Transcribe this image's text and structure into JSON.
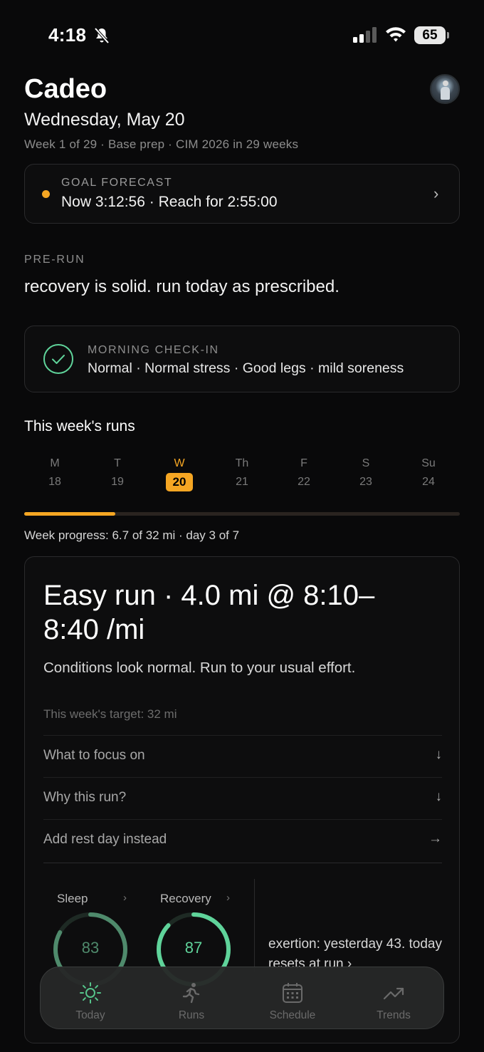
{
  "status": {
    "time": "4:18",
    "battery": "65"
  },
  "header": {
    "title": "Cadeo",
    "date": "Wednesday, May 20",
    "week_line": "Week 1 of 29 · Base prep · CIM 2026 in 29 weeks"
  },
  "goal": {
    "label": "GOAL FORECAST",
    "value": "Now 3:12:56 · Reach for 2:55:00",
    "accent": "#f5a623"
  },
  "prerun": {
    "label": "PRE-RUN",
    "text": "recovery is solid. run today as prescribed."
  },
  "checkin": {
    "label": "MORNING CHECK-IN",
    "text": "Normal · Normal stress · Good legs · mild soreness"
  },
  "week": {
    "title": "This week's runs",
    "days": [
      {
        "letter": "M",
        "num": "18"
      },
      {
        "letter": "T",
        "num": "19"
      },
      {
        "letter": "W",
        "num": "20"
      },
      {
        "letter": "Th",
        "num": "21"
      },
      {
        "letter": "F",
        "num": "22"
      },
      {
        "letter": "S",
        "num": "23"
      },
      {
        "letter": "Su",
        "num": "24"
      }
    ],
    "today_index": 2,
    "progress_fraction": 0.209,
    "progress_text": "Week progress: 6.7 of 32 mi · day 3 of 7"
  },
  "run": {
    "title": "Easy run · 4.0 mi @ 8:10–8:40 /mi",
    "subtitle": "Conditions look normal. Run to your usual effort.",
    "target": "This week's target: 32 mi",
    "rows": [
      {
        "label": "What to focus on",
        "arrow": "↓"
      },
      {
        "label": "Why this run?",
        "arrow": "↓"
      },
      {
        "label": "Add rest day instead",
        "arrow": "→"
      }
    ],
    "sleep": {
      "label": "Sleep",
      "value": "83",
      "fraction": 0.83,
      "color": "#4f8a6c"
    },
    "recovery": {
      "label": "Recovery",
      "value": "87",
      "fraction": 0.87,
      "color": "#5fd39a"
    },
    "exertion": "exertion: yesterday 43. today resets at run ›"
  },
  "tabs": [
    {
      "label": "Today",
      "icon": "sun-icon"
    },
    {
      "label": "Runs",
      "icon": "runner-icon"
    },
    {
      "label": "Schedule",
      "icon": "calendar-icon"
    },
    {
      "label": "Trends",
      "icon": "trend-icon"
    }
  ],
  "active_tab": 0
}
